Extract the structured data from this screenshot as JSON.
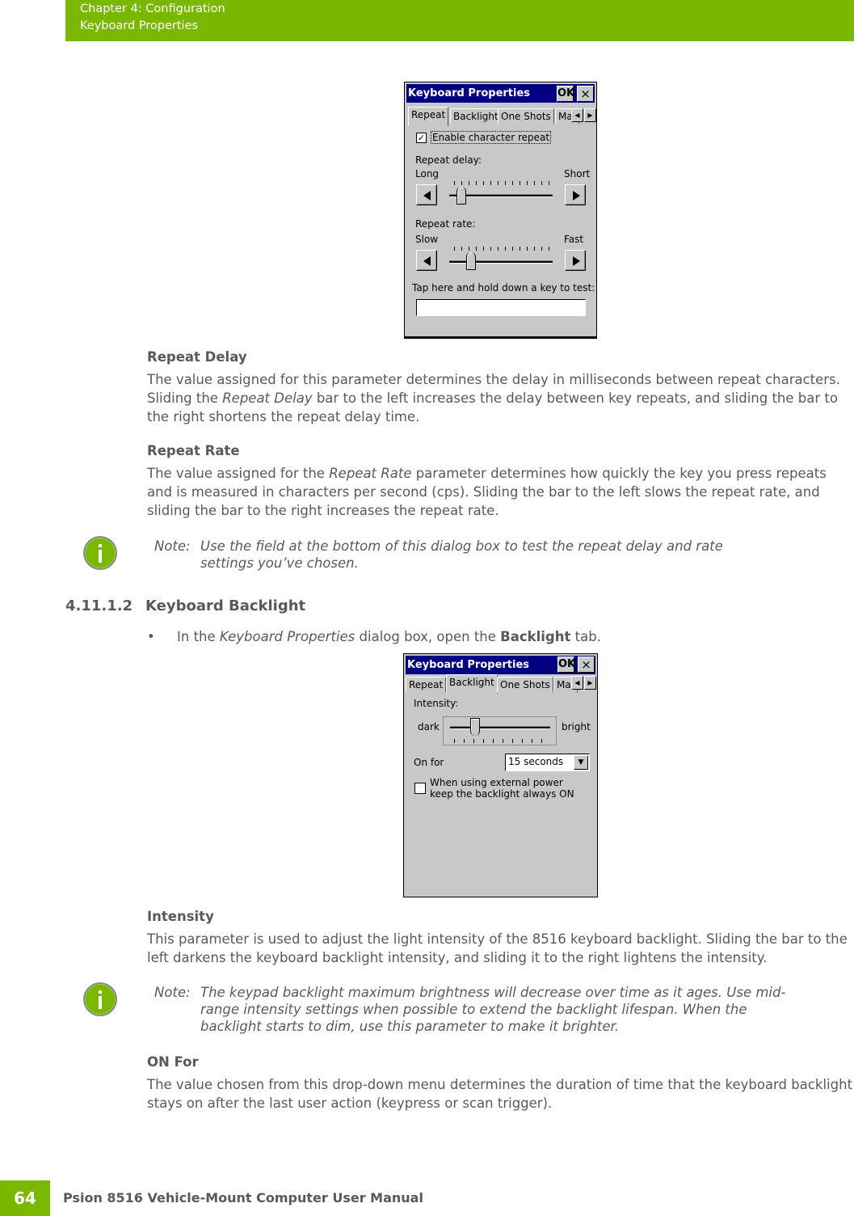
{
  "header": {
    "chapter": "Chapter 4:  Configuration",
    "section": "Keyboard Properties"
  },
  "dialog1": {
    "title": "Keyboard Properties",
    "ok": "OK",
    "close": "×",
    "tabs": [
      "Repeat",
      "Backlight",
      "One Shots",
      "Ma"
    ],
    "enable_repeat": "Enable character repeat",
    "enable_checked": true,
    "repeat_delay_label": "Repeat delay:",
    "delay_left": "Long",
    "delay_right": "Short",
    "delay_value_percent": 12,
    "repeat_rate_label": "Repeat rate:",
    "rate_left": "Slow",
    "rate_right": "Fast",
    "rate_value_percent": 21,
    "test_label": "Tap here and hold down a key to test:",
    "test_value": ""
  },
  "sections": {
    "repeat_delay_title": "Repeat Delay",
    "repeat_delay_body": [
      "The value assigned for this parameter determines the delay in milliseconds between repeat characters. Sliding the ",
      "Repeat Delay",
      " bar to the left increases the delay between key repeats, and sliding the bar to the right shortens the repeat delay time."
    ],
    "repeat_rate_title": "Repeat Rate",
    "repeat_rate_body": [
      "The value assigned for the ",
      "Repeat Rate",
      " parameter determines how quickly the key you press repeats and is measured in characters per second (cps). Sliding the bar to the left slows the repeat rate, and sliding the bar to the right increases the repeat rate."
    ],
    "note1_label": "Note:",
    "note1_text": "Use the field at the bottom of this dialog box to test the repeat delay and rate settings you’ve chosen.",
    "heading_num": "4.11.1.2",
    "heading_title": "Keyboard Backlight",
    "bullet": [
      "In the ",
      "Keyboard Properties",
      " dialog box, open the ",
      "Backlight",
      " tab."
    ],
    "intensity_title": "Intensity",
    "intensity_body": "This parameter is used to adjust the light intensity of the 8516 keyboard backlight. Sliding the bar to the left darkens the keyboard backlight intensity, and sliding it to the right lightens the intensity.",
    "note2_label": "Note:",
    "note2_text": "The keypad backlight maximum brightness will decrease over time as it ages. Use mid-range intensity settings when possible to extend the backlight lifespan. When the backlight starts to dim, use this parameter to make it brighter.",
    "onfor_title": "ON For",
    "onfor_body": "The value chosen from this drop-down menu determines the duration of time that the keyboard backlight stays on after the last user action (keypress or scan trigger)."
  },
  "dialog2": {
    "title": "Keyboard Properties",
    "ok": "OK",
    "close": "×",
    "tabs": [
      "Repeat",
      "Backlight",
      "One Shots",
      "Mac"
    ],
    "intensity_label": "Intensity:",
    "dark": "dark",
    "bright": "bright",
    "intensity_value_percent": 25,
    "on_for_label": "On for",
    "on_for_value": "15 seconds",
    "ext_power_label": "When using external power keep the backlight always ON",
    "ext_power_checked": false
  },
  "footer": {
    "page": "64",
    "title": "Psion 8516 Vehicle-Mount Computer User Manual"
  },
  "colors": {
    "brand_green": "#7ab800",
    "titlebar": "#000080",
    "text": "#58595b"
  }
}
